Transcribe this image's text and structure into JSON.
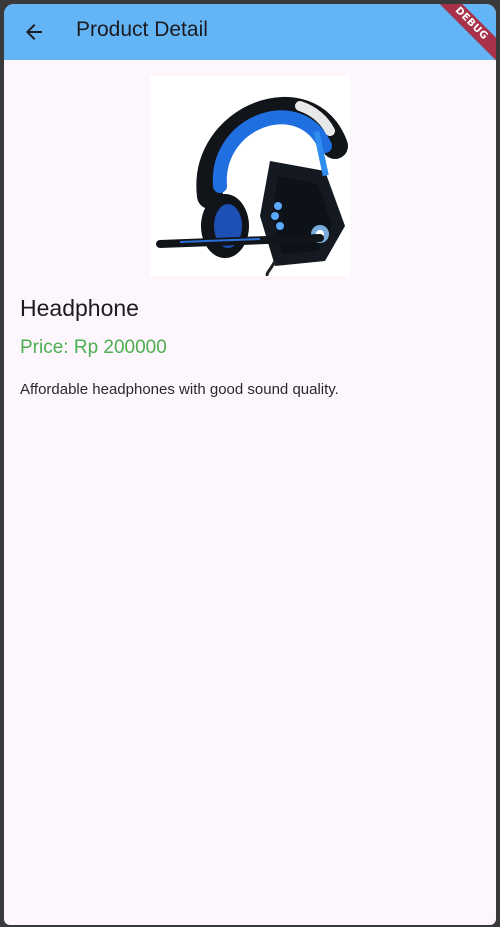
{
  "appbar": {
    "title": "Product Detail",
    "back_icon": "arrow-back-icon",
    "color": "#64b5f6",
    "debug_label": "DEBUG"
  },
  "product": {
    "image_icon": "headphone-image",
    "name": "Headphone",
    "price": "Price: Rp 200000",
    "price_color": "#4caf50",
    "description": "Affordable headphones with good sound quality."
  }
}
